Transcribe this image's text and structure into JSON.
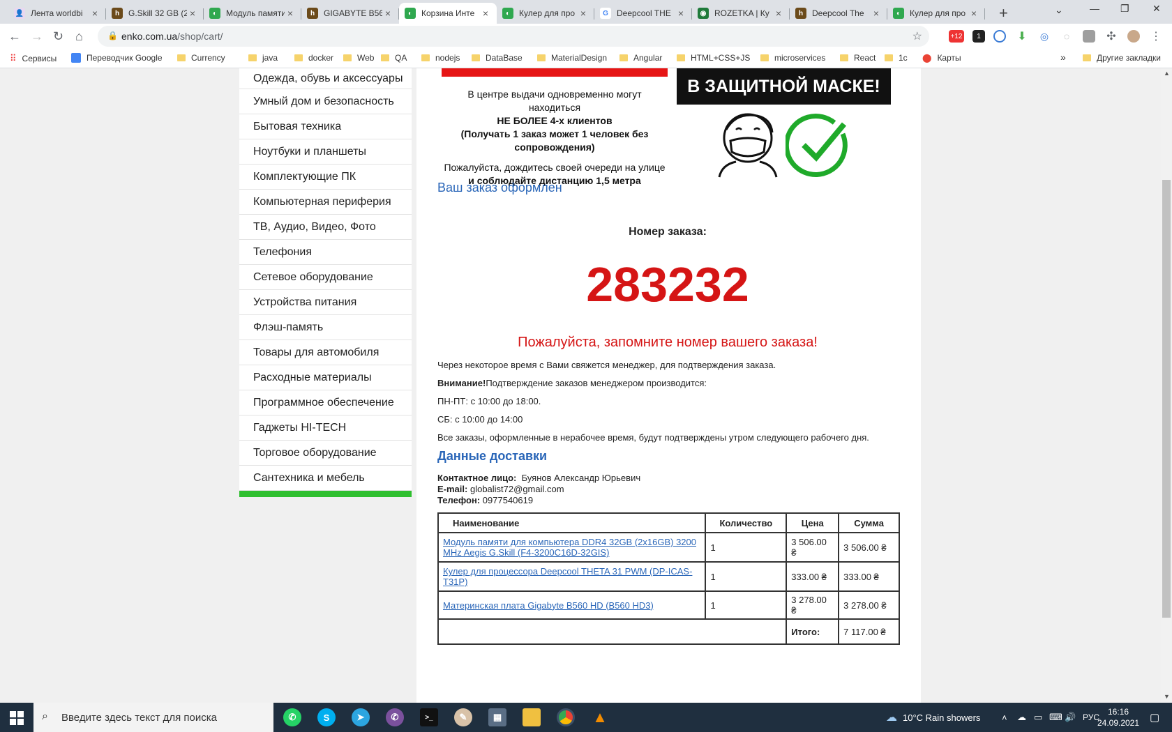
{
  "browser": {
    "tabs": [
      {
        "title": "Лента worldbi",
        "fav": "👤",
        "favbg": "#e8d8f0",
        "active": false
      },
      {
        "title": "G.Skill 32 GB (2",
        "fav": "h",
        "favbg": "#6b4a1a",
        "active": false
      },
      {
        "title": "Модуль памяти",
        "fav": "◐",
        "favbg": "#2fa84f",
        "active": false
      },
      {
        "title": "GIGABYTE B56",
        "fav": "h",
        "favbg": "#6b4a1a",
        "active": false
      },
      {
        "title": "Корзина Инте",
        "fav": "◐",
        "favbg": "#2fa84f",
        "active": true
      },
      {
        "title": "Кулер для про",
        "fav": "◐",
        "favbg": "#2fa84f",
        "active": false
      },
      {
        "title": "Deepcool THE",
        "fav": "G",
        "favbg": "#ffffff",
        "active": false
      },
      {
        "title": "ROZETKA | Ку",
        "fav": "◉",
        "favbg": "#1f7a3a",
        "active": false
      },
      {
        "title": "Deepcool The",
        "fav": "h",
        "favbg": "#6b4a1a",
        "active": false
      },
      {
        "title": "Кулер для про",
        "fav": "◐",
        "favbg": "#2fa84f",
        "active": false
      }
    ],
    "url_host": "enko.com.ua",
    "url_path": "/shop/cart/",
    "badges": {
      "ext1": "+12",
      "ext2": "1"
    }
  },
  "bookmarks": {
    "apps": "Сервисы",
    "items": [
      "Переводчик Google",
      "Currency",
      "java",
      "docker",
      "Web",
      "QA",
      "nodejs",
      "DataBase",
      "MaterialDesign",
      "Angular",
      "HTML+CSS+JS",
      "microservices",
      "React",
      "1c",
      "Карты"
    ],
    "more": "»",
    "other": "Другие закладки"
  },
  "sidebar": {
    "categories": [
      "Одежда, обувь и аксессуары",
      "Умный дом и безопасность",
      "Бытовая техника",
      "Ноутбуки и планшеты",
      "Комплектующие ПК",
      "Компьютерная периферия",
      "ТВ, Аудио, Видео, Фото",
      "Телефония",
      "Сетевое оборудование",
      "Устройства питания",
      "Флэш-память",
      "Товары для автомобиля",
      "Расходные материалы",
      "Программное обеспечение",
      "Гаджеты HI-TECH",
      "Торговое оборудование",
      "Сантехника и мебель"
    ]
  },
  "banner": {
    "line1": "В центре выдачи одновременно могут находиться",
    "line2": "НЕ БОЛЕЕ 4-х клиентов",
    "line3": "(Получать 1 заказ может 1 человек без сопровождения)",
    "line4": "Пожалуйста, дождитесь своей очереди на улице",
    "line5": "и соблюдайте дистанцию 1,5 метра",
    "mask": "В ЗАЩИТНОЙ МАСКЕ!"
  },
  "order": {
    "heading": "Ваш заказ оформлен",
    "number_label": "Номер заказа:",
    "number": "283232",
    "remember": "Пожалуйста, запомните номер вашего заказа!",
    "note1": "Через некоторое время с Вами свяжется менеджер, для подтверждения заказа.",
    "attention_label": "Внимание!",
    "attention_text": "Подтверждение заказов менеджером производится:",
    "hours_weekdays": "ПН-ПТ: с 10:00 до 18:00.",
    "hours_sat": "СБ: с 10:00 до 14:00",
    "note2": "Все заказы, оформленные в нерабочее время, будут подтверждены утром следующего рабочего дня."
  },
  "delivery": {
    "heading": "Данные доставки",
    "contact_label": "Контактное лицо:",
    "contact_value": "Буянов Александр Юрьевич",
    "email_label": "E-mail:",
    "email_value": "globalist72@gmail.com",
    "phone_label": "Телефон:",
    "phone_value": "0977540619"
  },
  "table": {
    "headers": [
      "Наименование",
      "Количество",
      "Цена",
      "Сумма"
    ],
    "rows": [
      {
        "name": "Модуль памяти для компьютера DDR4 32GB (2x16GB) 3200 MHz Aegis G.Skill (F4-3200C16D-32GIS)",
        "qty": "1",
        "price": "3 506.00 ₴",
        "sum": "3 506.00 ₴"
      },
      {
        "name": "Кулер для процессора Deepcool THETA 31 PWM (DP-ICAS-T31P)",
        "qty": "1",
        "price": "333.00 ₴",
        "sum": "333.00 ₴"
      },
      {
        "name": "Материнская плата Gigabyte B560 HD (B560 HD3)",
        "qty": "1",
        "price": "3 278.00 ₴",
        "sum": "3 278.00 ₴"
      }
    ],
    "total_label": "Итого:",
    "total_value": "7 117.00 ₴"
  },
  "taskbar": {
    "search_placeholder": "Введите здесь текст для поиска",
    "weather": "10°C  Rain showers",
    "lang": "РУС",
    "time": "16:16",
    "date": "24.09.2021"
  }
}
